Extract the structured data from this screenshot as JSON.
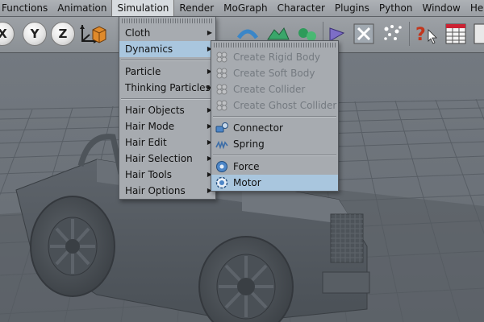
{
  "menubar": [
    "Functions",
    "Animation",
    "Simulation",
    "Render",
    "MoGraph",
    "Character",
    "Plugins",
    "Python",
    "Window",
    "Help"
  ],
  "toolbar": {
    "x_axis": "X",
    "y_axis": "Y",
    "z_axis": "Z"
  },
  "simulation_menu": {
    "items": [
      "Cloth",
      "Dynamics",
      "Particle",
      "Thinking Particles",
      "Hair Objects",
      "Hair Mode",
      "Hair Edit",
      "Hair Selection",
      "Hair Tools",
      "Hair Options"
    ]
  },
  "dynamics_menu": {
    "items": [
      "Create Rigid Body",
      "Create Soft Body",
      "Create Collider",
      "Create Ghost Collider",
      "Connector",
      "Spring",
      "Force",
      "Motor"
    ]
  },
  "colors": {
    "highlight": "#a9c6de",
    "menu_bg": "#a7abb0",
    "viewport": "#62686f"
  }
}
